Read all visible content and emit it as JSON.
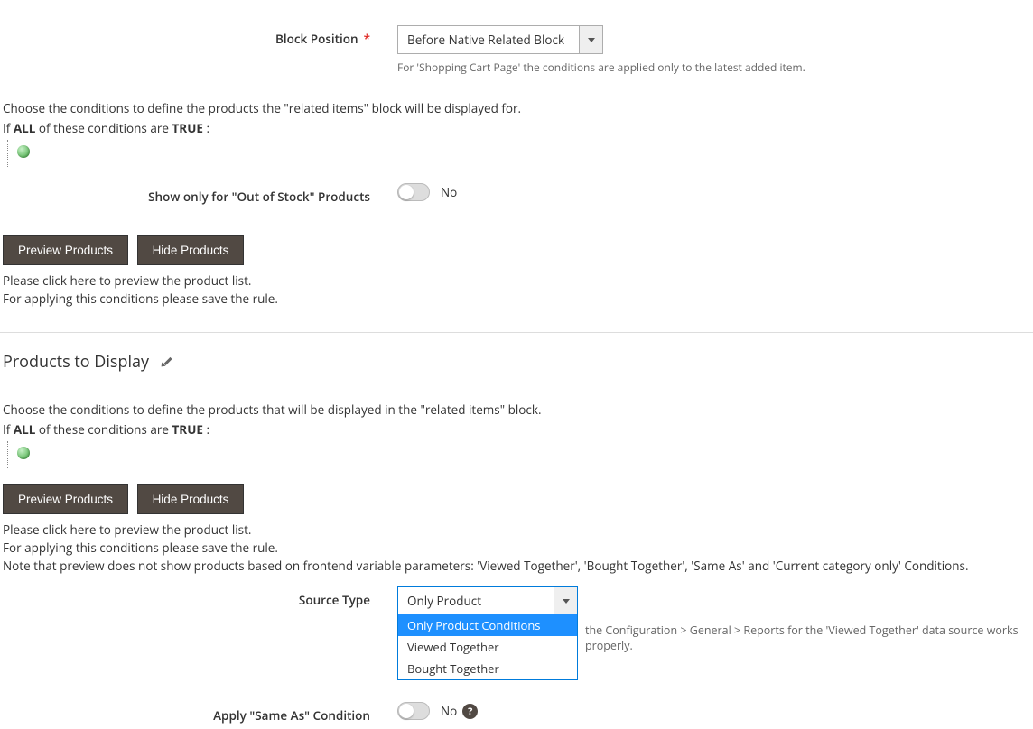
{
  "blockPosition": {
    "label": "Block Position",
    "value": "Before Native Related Block",
    "note": "For 'Shopping Cart Page' the conditions are applied only to the latest added item."
  },
  "conditionsDisplayedFor": {
    "intro": "Choose the conditions to define the products the \"related items\" block will be displayed for.",
    "if_prefix": "If ",
    "if_all": "ALL",
    "if_mid": " of these conditions are ",
    "if_true": "TRUE",
    "if_suffix": " :"
  },
  "outOfStock": {
    "label": "Show only for \"Out of Stock\" Products",
    "value": "No"
  },
  "buttons": {
    "preview": "Preview Products",
    "hide": "Hide Products"
  },
  "previewInfo": {
    "line1": "Please click here to preview the product list.",
    "line2": "For applying this conditions please save the rule."
  },
  "productsToDisplay": {
    "title": "Products to Display",
    "intro": "Choose the conditions to define the products that will be displayed in the \"related items\" block.",
    "noteExtra": "Note that preview does not show products based on frontend variable parameters: 'Viewed Together', 'Bought Together', 'Same As' and 'Current category only' Conditions."
  },
  "sourceType": {
    "label": "Source Type",
    "value": "Only Product Conditions",
    "options": [
      "Only Product Conditions",
      "Viewed Together",
      "Bought Together"
    ],
    "hint": "the Configuration > General > Reports for the 'Viewed Together' data source works properly."
  },
  "sameAs": {
    "label": "Apply \"Same As\" Condition",
    "value": "No"
  }
}
